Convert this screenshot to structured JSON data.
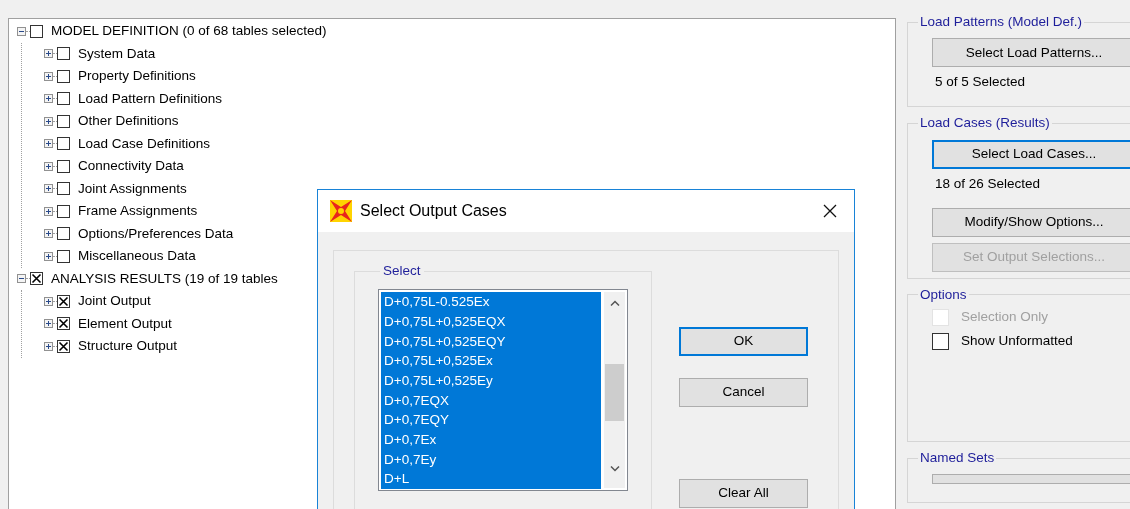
{
  "tree": [
    {
      "label": "MODEL DEFINITION  (0 of 68 tables selected)",
      "checked": false,
      "expanded": true,
      "children": [
        {
          "label": "System Data",
          "checked": false,
          "expanded": false
        },
        {
          "label": "Property Definitions",
          "checked": false,
          "expanded": false
        },
        {
          "label": "Load Pattern Definitions",
          "checked": false,
          "expanded": false
        },
        {
          "label": "Other Definitions",
          "checked": false,
          "expanded": false
        },
        {
          "label": "Load Case Definitions",
          "checked": false,
          "expanded": false
        },
        {
          "label": "Connectivity Data",
          "checked": false,
          "expanded": false
        },
        {
          "label": "Joint Assignments",
          "checked": false,
          "expanded": false
        },
        {
          "label": "Frame Assignments",
          "checked": false,
          "expanded": false
        },
        {
          "label": "Options/Preferences Data",
          "checked": false,
          "expanded": false
        },
        {
          "label": "Miscellaneous Data",
          "checked": false,
          "expanded": false
        }
      ]
    },
    {
      "label": "ANALYSIS RESULTS  (19 of 19 tables",
      "checked": true,
      "expanded": true,
      "children": [
        {
          "label": "Joint Output",
          "checked": true,
          "expanded": false
        },
        {
          "label": "Element Output",
          "checked": true,
          "expanded": false
        },
        {
          "label": "Structure Output",
          "checked": true,
          "expanded": false
        }
      ]
    }
  ],
  "side_panel": {
    "groups": [
      {
        "title": "Load Patterns (Model Def.)",
        "items": [
          {
            "kind": "button",
            "label": "Select Load Patterns...",
            "focused": false,
            "disabled": false
          },
          {
            "kind": "text",
            "label": "5 of 5 Selected"
          }
        ]
      },
      {
        "title": "Load Cases (Results)",
        "items": [
          {
            "kind": "button",
            "label": "Select Load Cases...",
            "focused": true,
            "disabled": false
          },
          {
            "kind": "text",
            "label": "18 of 26 Selected"
          },
          {
            "kind": "button",
            "label": "Modify/Show Options...",
            "focused": false,
            "disabled": false
          },
          {
            "kind": "button",
            "label": "Set Output Selections...",
            "focused": false,
            "disabled": true
          }
        ]
      },
      {
        "title": "Options",
        "items": [
          {
            "kind": "checkbox",
            "label": "Selection Only",
            "checked": false,
            "disabled": true
          },
          {
            "kind": "checkbox",
            "label": "Show Unformatted",
            "checked": false,
            "disabled": false
          }
        ]
      },
      {
        "title": "Named Sets"
      }
    ]
  },
  "dialog": {
    "title": "Select Output Cases",
    "group_title": "Select",
    "cases": [
      {
        "label": "D+0,75L-0.525Ex",
        "selected": true
      },
      {
        "label": "D+0,75L+0,525EQX",
        "selected": true
      },
      {
        "label": "D+0,75L+0,525EQY",
        "selected": true
      },
      {
        "label": "D+0,75L+0,525Ex",
        "selected": true
      },
      {
        "label": "D+0,75L+0,525Ey",
        "selected": true
      },
      {
        "label": "D+0,7EQX",
        "selected": true
      },
      {
        "label": "D+0,7EQY",
        "selected": true
      },
      {
        "label": "D+0,7Ex",
        "selected": true
      },
      {
        "label": "D+0,7Ey",
        "selected": true
      },
      {
        "label": "D+L",
        "selected": true
      }
    ],
    "buttons": [
      {
        "label": "OK",
        "focused": true
      },
      {
        "label": "Cancel",
        "focused": false
      },
      {
        "label": "Clear All",
        "focused": false
      }
    ]
  }
}
